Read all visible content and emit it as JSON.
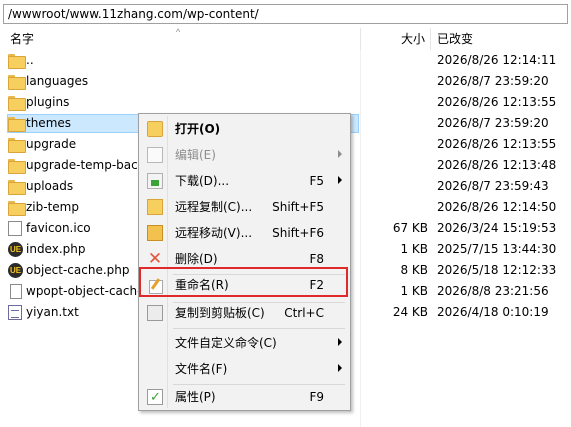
{
  "path": "/wwwroot/www.11zhang.com/wp-content/",
  "columns": {
    "name": "名字",
    "size": "大小",
    "modified": "已改变"
  },
  "files": [
    {
      "name": "..",
      "type": "parent",
      "size": "",
      "modified": "2026/8/26 12:14:11"
    },
    {
      "name": "languages",
      "type": "folder",
      "size": "",
      "modified": "2026/8/7 23:59:20"
    },
    {
      "name": "plugins",
      "type": "folder",
      "size": "",
      "modified": "2026/8/26 12:13:55"
    },
    {
      "name": "themes",
      "type": "folder",
      "size": "",
      "modified": "2026/8/7 23:59:20",
      "selected": true
    },
    {
      "name": "upgrade",
      "type": "folder",
      "size": "",
      "modified": "2026/8/26 12:13:55"
    },
    {
      "name": "upgrade-temp-bac",
      "type": "folder",
      "size": "",
      "modified": "2026/8/26 12:13:48"
    },
    {
      "name": "uploads",
      "type": "folder",
      "size": "",
      "modified": "2026/8/7 23:59:43"
    },
    {
      "name": "zib-temp",
      "type": "folder",
      "size": "",
      "modified": "2026/8/26 12:14:50"
    },
    {
      "name": "favicon.ico",
      "type": "ico",
      "size": "67 KB",
      "modified": "2026/3/24 15:19:53"
    },
    {
      "name": "index.php",
      "type": "php",
      "size": "1 KB",
      "modified": "2025/7/15 13:44:30"
    },
    {
      "name": "object-cache.php",
      "type": "php",
      "size": "8 KB",
      "modified": "2026/5/18 12:12:33"
    },
    {
      "name": "wpopt-object-cache",
      "type": "file",
      "size": "1 KB",
      "modified": "2026/8/8 23:21:56"
    },
    {
      "name": "yiyan.txt",
      "type": "txt",
      "size": "24 KB",
      "modified": "2026/4/18 0:10:19"
    }
  ],
  "context_menu": [
    {
      "label": "打开(O)",
      "shortcut": "",
      "icon": "open-icon",
      "bold": true
    },
    {
      "label": "编辑(E)",
      "shortcut": "",
      "icon": "edit-icon",
      "disabled": true,
      "submenu": true
    },
    {
      "label": "下载(D)...",
      "shortcut": "F5",
      "icon": "download-icon",
      "submenu": true
    },
    {
      "label": "远程复制(C)...",
      "shortcut": "Shift+F5",
      "icon": "remote-copy-icon"
    },
    {
      "label": "远程移动(V)...",
      "shortcut": "Shift+F6",
      "icon": "remote-move-icon"
    },
    {
      "label": "删除(D)",
      "shortcut": "F8",
      "icon": "delete-icon"
    },
    {
      "label": "重命名(R)",
      "shortcut": "F2",
      "icon": "rename-icon",
      "highlighted": true
    },
    {
      "label": "复制到剪贴板(C)",
      "shortcut": "Ctrl+C",
      "icon": "clipboard-icon"
    },
    {
      "label": "文件自定义命令(C)",
      "shortcut": "",
      "icon": "",
      "submenu": true
    },
    {
      "label": "文件名(F)",
      "shortcut": "",
      "icon": "",
      "submenu": true
    },
    {
      "label": "属性(P)",
      "shortcut": "F9",
      "icon": "properties-icon"
    }
  ],
  "colors": {
    "highlight_border": "#e02a2a",
    "selection": "#cce8ff",
    "folder": "#f7cf5e"
  }
}
